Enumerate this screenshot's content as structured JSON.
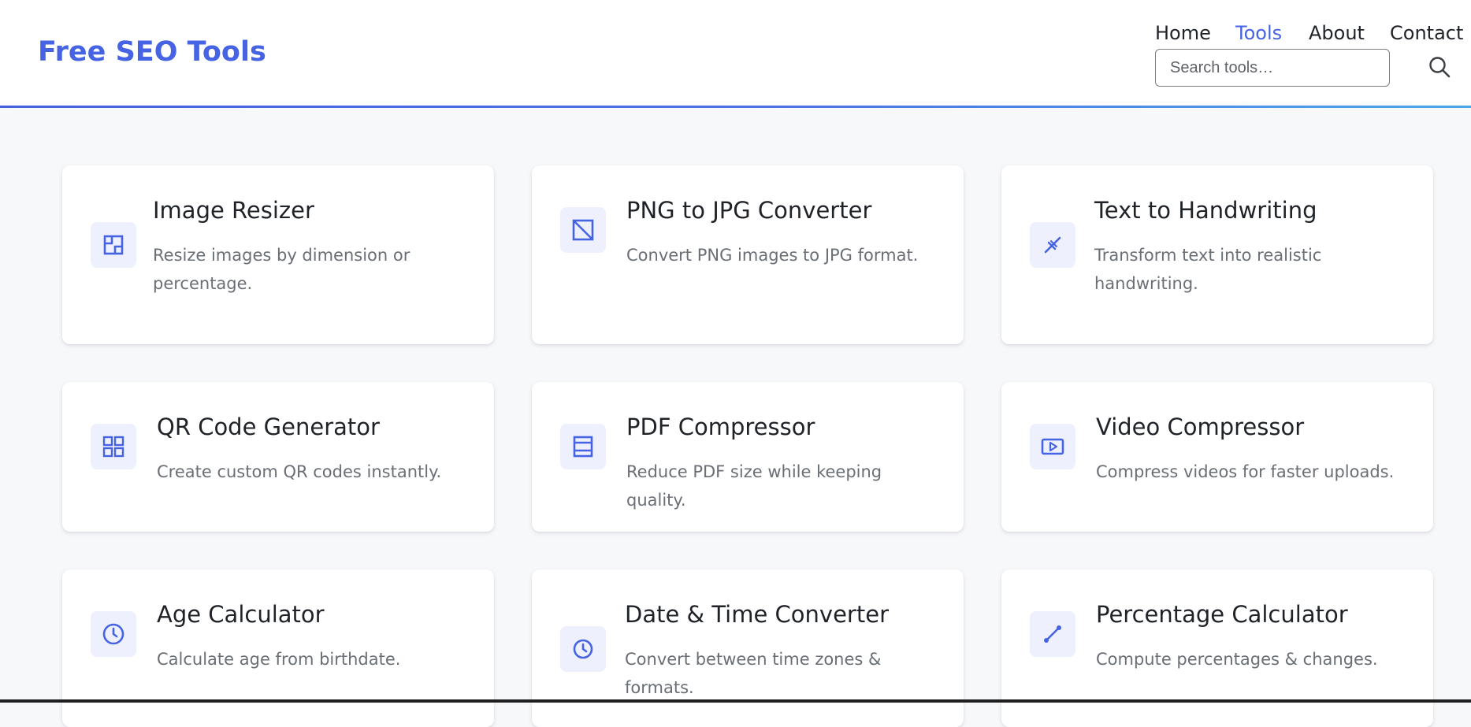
{
  "brand": {
    "logo": "Free SEO Tools",
    "accent": "#4563e3"
  },
  "nav": {
    "items": [
      {
        "label": "Home",
        "active": false
      },
      {
        "label": "Tools",
        "active": true
      },
      {
        "label": "About",
        "active": false
      },
      {
        "label": "Contact",
        "active": false
      }
    ]
  },
  "search": {
    "placeholder": "Search tools…",
    "value": "",
    "icon": "search-icon"
  },
  "tools": [
    {
      "title": "Image Resizer",
      "description": "Resize images by dimension or percentage.",
      "icon": "resize-icon"
    },
    {
      "title": "PNG to JPG Converter",
      "description": "Convert PNG images to JPG format.",
      "icon": "convert-icon"
    },
    {
      "title": "Text to Handwriting",
      "description": "Transform text into realistic handwriting.",
      "icon": "pen-icon"
    },
    {
      "title": "QR Code Generator",
      "description": "Create custom QR codes instantly.",
      "icon": "qr-code-icon"
    },
    {
      "title": "PDF Compressor",
      "description": "Reduce PDF size while keeping quality.",
      "icon": "document-icon"
    },
    {
      "title": "Video Compressor",
      "description": "Compress videos for faster uploads.",
      "icon": "video-icon"
    },
    {
      "title": "Age Calculator",
      "description": "Calculate age from birthdate.",
      "icon": "clock-icon"
    },
    {
      "title": "Date & Time Converter",
      "description": "Convert between time zones & formats.",
      "icon": "clock-icon"
    },
    {
      "title": "Percentage Calculator",
      "description": "Compute percentages & changes.",
      "icon": "percent-icon"
    }
  ]
}
